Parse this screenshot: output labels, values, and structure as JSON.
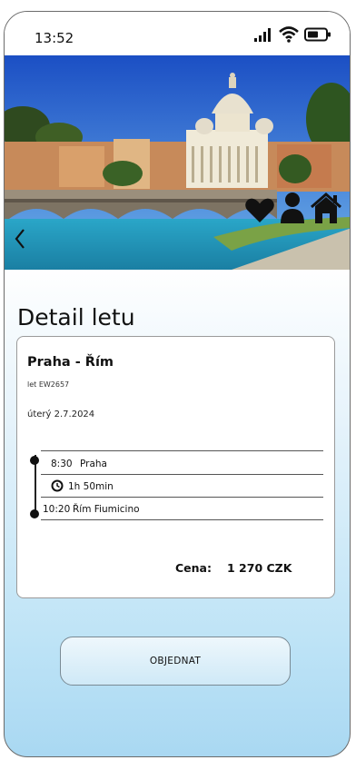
{
  "status_bar": {
    "time": "13:52"
  },
  "page": {
    "title": "Detail letu"
  },
  "flight": {
    "route": "Praha - Řím",
    "flight_number": "let EW2657",
    "date": "úterý 2.7.2024",
    "departure": {
      "time": "8:30",
      "place": "Praha"
    },
    "duration": "1h 50min",
    "arrival": {
      "time": "10:20",
      "place": "Řím Fiumicino"
    },
    "price_label": "Cena:",
    "price_value": "1 270 CZK"
  },
  "actions": {
    "order_label": "OBJEDNAT"
  },
  "icons": {
    "status": [
      "signal-icon",
      "wifi-icon",
      "battery-icon"
    ],
    "hero": [
      "heart-icon",
      "user-icon",
      "home-icon",
      "back-chevron-icon"
    ],
    "duration": "clock-icon"
  }
}
